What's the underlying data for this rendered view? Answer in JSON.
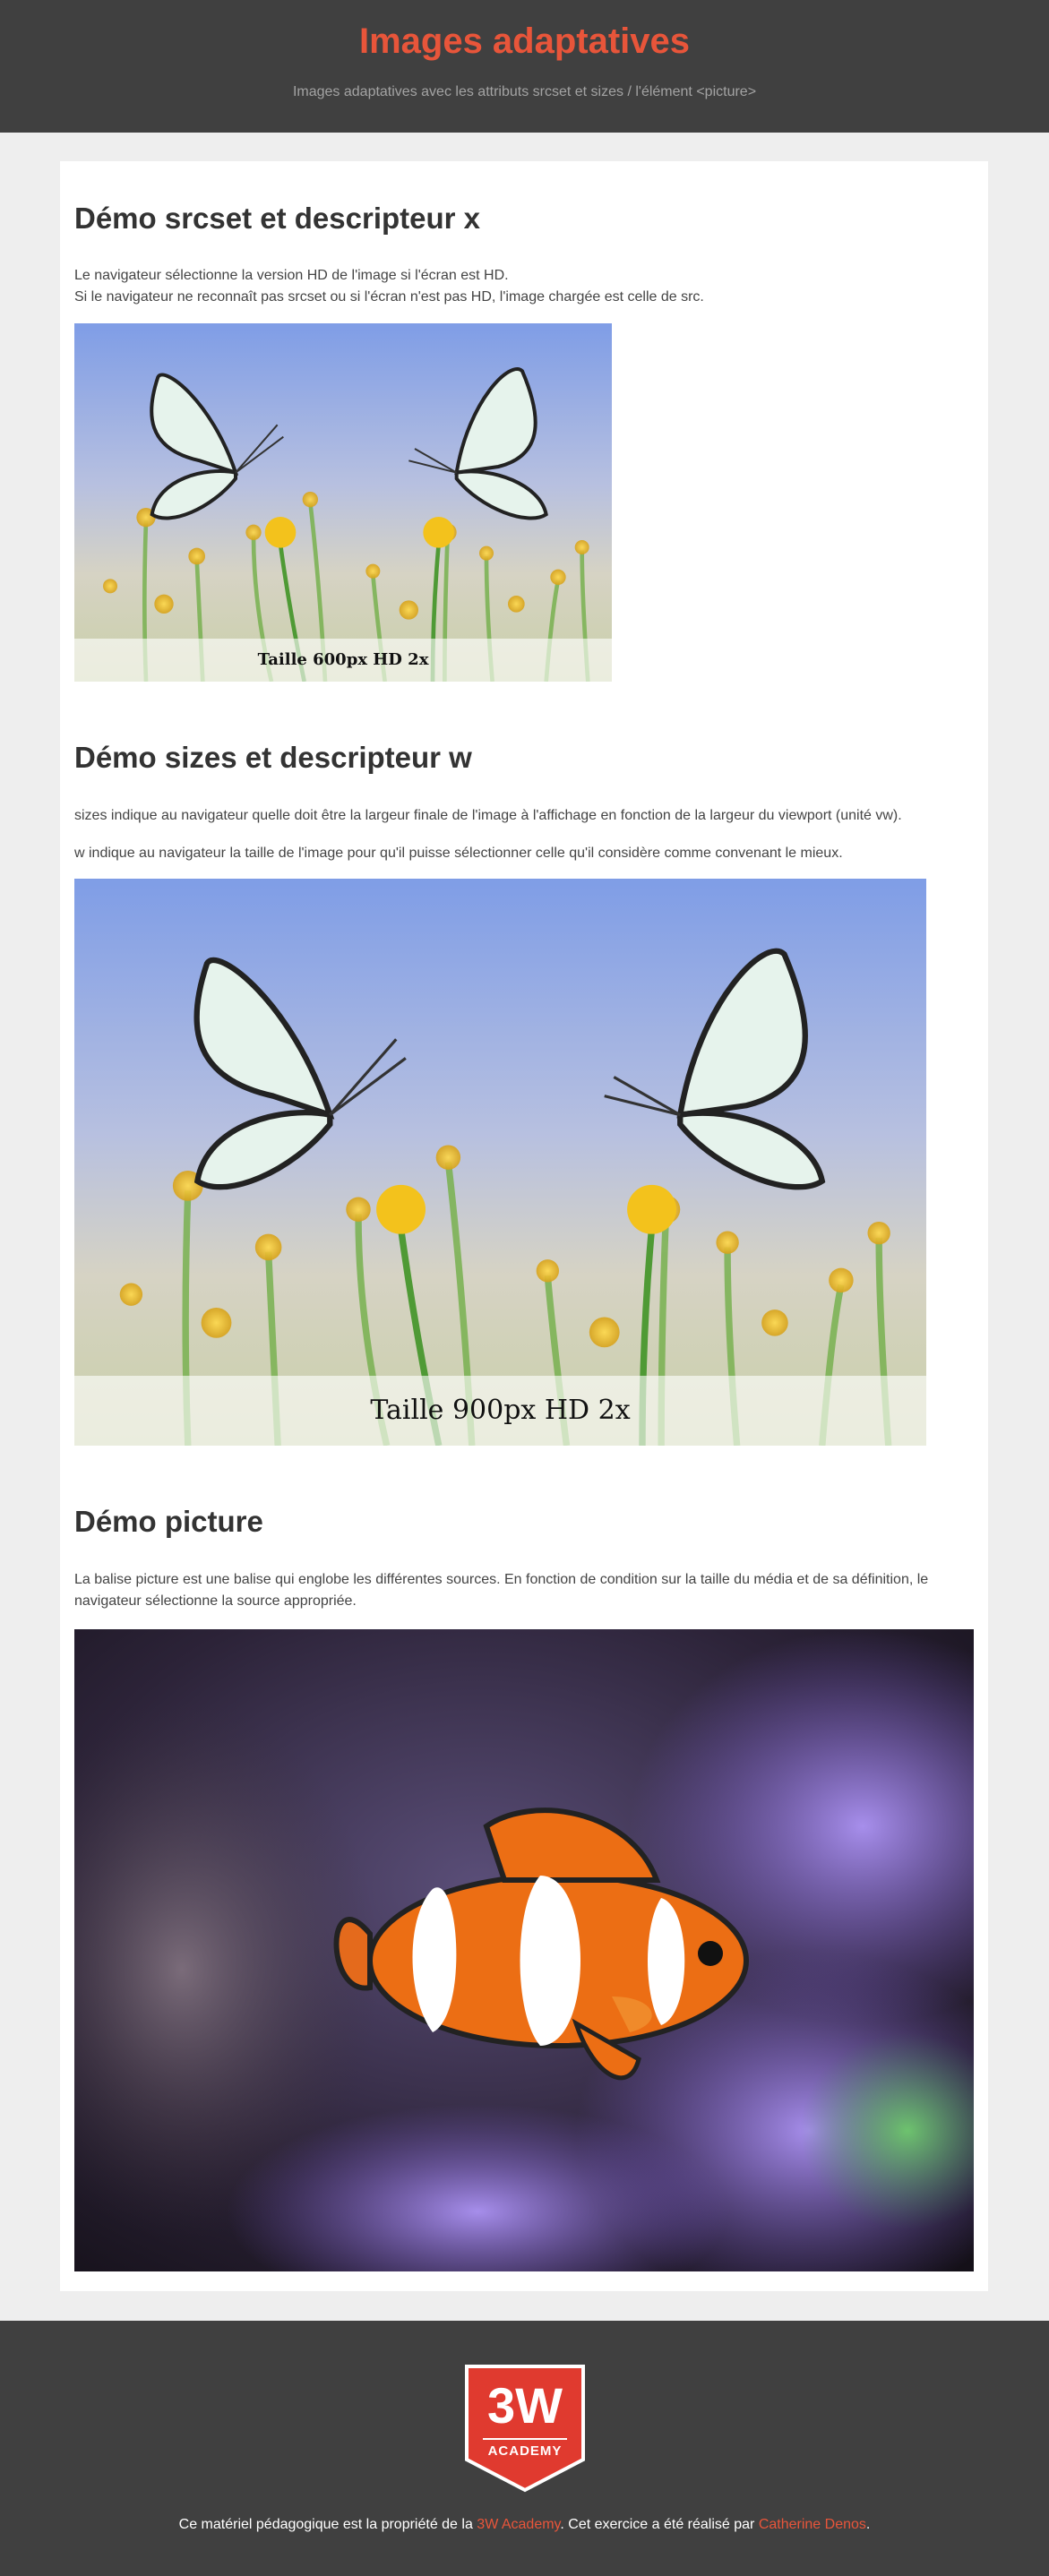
{
  "header": {
    "title": "Images adaptatives",
    "subtitle": "Images adaptatives avec les attributs srcset et sizes / l'élément <picture>"
  },
  "sections": [
    {
      "title": "Démo srcset et descripteur x",
      "paragraphs": [
        "Le navigateur sélectionne la version HD de l'image si l'écran est HD.",
        "Si le navigateur ne reconnaît pas srcset ou si l'écran n'est pas HD, l'image chargée est celle de src."
      ],
      "image_caption": "Taille 600px HD 2x"
    },
    {
      "title": "Démo sizes et descripteur w",
      "paragraphs": [
        "sizes indique au navigateur quelle doit être la largeur finale de l'image à l'affichage en fonction de la largeur du viewport (unité vw).",
        "w indique au navigateur la taille de l'image pour qu'il puisse sélectionner celle qu'il considère comme convenant le mieux."
      ],
      "image_caption": "Taille 900px HD 2x"
    },
    {
      "title": "Démo picture",
      "paragraphs": [
        "La balise picture est une balise qui englobe les différentes sources. En fonction de condition sur la taille du média et de sa définition, le navigateur sélectionne la source appropriée."
      ]
    }
  ],
  "footer": {
    "logo_top": "3W",
    "logo_bottom": "ACADEMY",
    "text_before": "Ce matériel pédagogique est la propriété de la ",
    "link1": "3W Academy",
    "text_middle": ". Cet exercice a été réalisé par ",
    "link2": "Catherine Denos",
    "text_after": "."
  },
  "colors": {
    "accent": "#e8553a",
    "header_bg": "#404040"
  }
}
